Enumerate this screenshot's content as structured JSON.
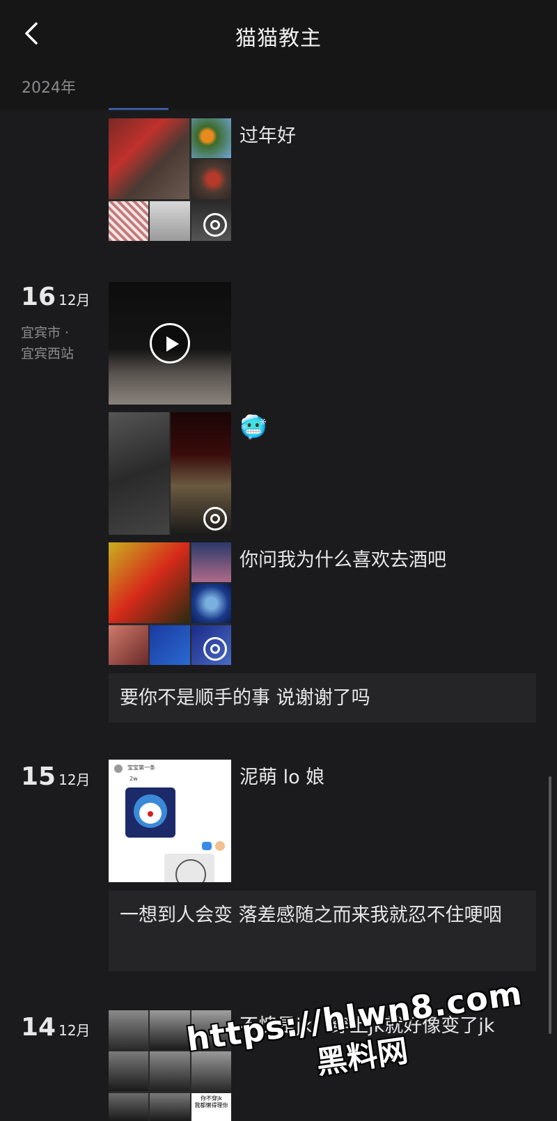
{
  "header": {
    "title": "猫猫教主",
    "year": "2024年"
  },
  "posts": [
    {
      "caption": "过年好"
    },
    {
      "day": "16",
      "month": "12月",
      "location_line1": "宜宾市 ·",
      "location_line2": "宜宾西站",
      "emoji": "🥶",
      "caption2": "你问我为什么喜欢去酒吧",
      "text": "要你不是顺手的事 说谢谢了吗"
    },
    {
      "day": "15",
      "month": "12月",
      "caption": "泥萌 lo 娘",
      "text": "一想到人会变 落差感随之而来我就忍不住哽咽",
      "thumb_title": "宝宝第一条",
      "thumb_sub": "2w"
    },
    {
      "day": "14",
      "month": "12月",
      "caption": "不愧是jk，穿上jk就好像变了jk",
      "thumb_text1": "你不穿jk",
      "thumb_text2": "我都懒得理你"
    }
  ],
  "watermark": {
    "url": "https://hlwn8.com",
    "brand": "黑料网"
  },
  "colors": {
    "background": "#1b1b1d",
    "card": "#252527",
    "accent": "#3a5ba3"
  },
  "icons": [
    "back-arrow-icon",
    "multi-image-icon",
    "play-icon",
    "cold-face-emoji"
  ]
}
